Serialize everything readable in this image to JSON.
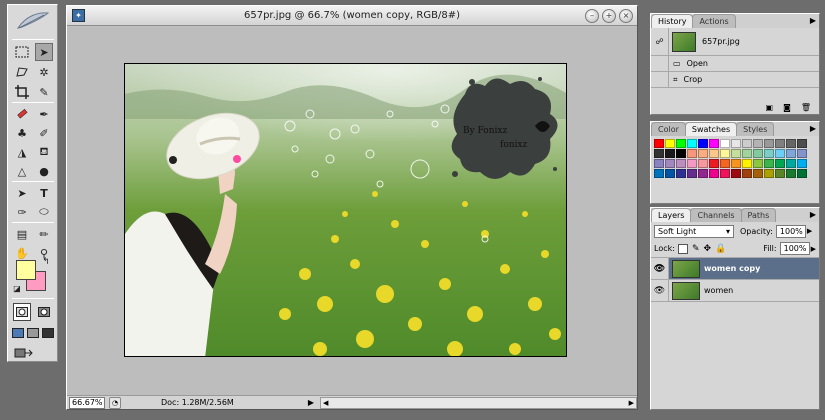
{
  "document": {
    "title": "657pr.jpg @ 66.7% (women copy, RGB/8#)",
    "zoom": "66.67%",
    "doc_size": "Doc: 1.28M/2.56M",
    "photo": {
      "logo_text_1": "By Fonixz",
      "logo_text_2": "fonixz"
    }
  },
  "toolbox": {
    "foreground_color": "#ffffa0",
    "background_color": "#ff9ac0",
    "tools": [
      "marquee-icon",
      "move-icon",
      "lasso-icon",
      "magic-wand-icon",
      "crop-icon",
      "slice-icon",
      "healing-brush-icon",
      "brush-icon",
      "clone-stamp-icon",
      "history-brush-icon",
      "eraser-icon",
      "paint-bucket-icon",
      "blur-icon",
      "dodge-icon",
      "path-selection-icon",
      "type-icon",
      "pen-icon",
      "shape-icon",
      "notes-icon",
      "eyedropper-icon",
      "hand-icon",
      "zoom-icon"
    ]
  },
  "history": {
    "tabs": [
      "History",
      "Actions"
    ],
    "snapshot": "657pr.jpg",
    "states": [
      "Open",
      "Crop"
    ]
  },
  "swatches": {
    "tabs": [
      "Color",
      "Swatches",
      "Styles"
    ],
    "colors": [
      "#ff0000",
      "#ffff00",
      "#00ff00",
      "#00ffff",
      "#0000ff",
      "#ff00ff",
      "#ffffff",
      "#e6e6e6",
      "#cccccc",
      "#b3b3b3",
      "#999999",
      "#808080",
      "#666666",
      "#4d4d4d",
      "#333333",
      "#1a1a1a",
      "#000000",
      "#f7977a",
      "#f9ad81",
      "#fdc68a",
      "#fff79a",
      "#c4df9b",
      "#a3d39c",
      "#82ca9d",
      "#7bcdc8",
      "#6ecff6",
      "#7ea7d8",
      "#8493ca",
      "#8882be",
      "#a187be",
      "#bc8dbf",
      "#f49ac2",
      "#f6989d",
      "#ed1c24",
      "#f26522",
      "#f7941d",
      "#fff200",
      "#8dc63f",
      "#39b54a",
      "#00a651",
      "#00a99d",
      "#00aeef",
      "#0072bc",
      "#0054a6",
      "#2e3192",
      "#662d91",
      "#92278f",
      "#ec008c",
      "#ed145b",
      "#9e0b0f",
      "#a0410d",
      "#a36209",
      "#aba000",
      "#598527",
      "#1a7b30",
      "#007236"
    ]
  },
  "layers": {
    "tabs": [
      "Layers",
      "Channels",
      "Paths"
    ],
    "blend_mode": "Soft Light",
    "opacity_label": "Opacity:",
    "opacity": "100%",
    "lock_label": "Lock:",
    "fill_label": "Fill:",
    "fill": "100%",
    "items": [
      {
        "name": "women copy",
        "selected": true
      },
      {
        "name": "women",
        "selected": false
      }
    ]
  }
}
